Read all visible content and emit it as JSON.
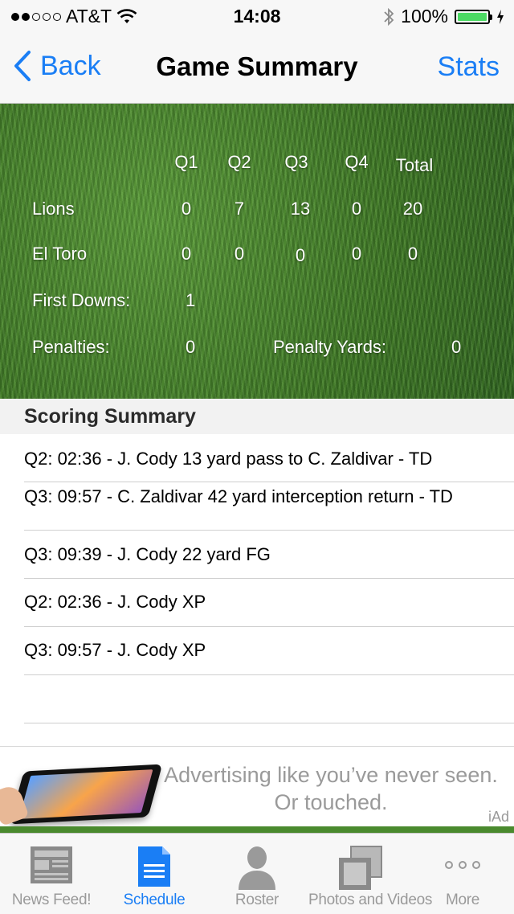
{
  "status_bar": {
    "carrier": "AT&T",
    "time": "14:08",
    "battery": "100%",
    "battery_level": 1.0,
    "signal_bars": 2
  },
  "nav": {
    "back_label": "Back",
    "title": "Game Summary",
    "right_label": "Stats"
  },
  "scoreboard": {
    "headers": [
      "Q1",
      "Q2",
      "Q3",
      "Q4",
      "Total"
    ],
    "teams": [
      {
        "name": "Lions",
        "scores": [
          "0",
          "7",
          "13",
          "0",
          "20"
        ]
      },
      {
        "name": "El Toro",
        "scores": [
          "0",
          "0",
          "0",
          "0",
          "0"
        ]
      }
    ],
    "first_downs_label": "First Downs:",
    "first_downs_value": "1",
    "penalties_label": "Penalties:",
    "penalties_value": "0",
    "penalty_yards_label": "Penalty Yards:",
    "penalty_yards_value": "0"
  },
  "scoring_summary": {
    "title": "Scoring Summary",
    "plays": [
      "Q2: 02:36 - J. Cody 13 yard pass to C. Zaldivar - TD",
      "Q3: 09:57 - C. Zaldivar 42 yard interception return - TD",
      "Q3: 09:39 - J. Cody 22 yard FG",
      "Q2: 02:36 - J. Cody XP",
      "Q3: 09:57 - J. Cody XP",
      ""
    ]
  },
  "ad": {
    "line1": "Advertising like you’ve never seen.",
    "line2": "Or touched.",
    "badge": "iAd"
  },
  "tabs": [
    {
      "label": "News Feed!",
      "icon": "newspaper-icon",
      "active": false
    },
    {
      "label": "Schedule",
      "icon": "document-icon",
      "active": true
    },
    {
      "label": "Roster",
      "icon": "person-icon",
      "active": false
    },
    {
      "label": "Photos and Videos",
      "icon": "photos-icon",
      "active": false
    },
    {
      "label": "More",
      "icon": "more-icon",
      "active": false
    }
  ],
  "colors": {
    "accent": "#1a7ef5",
    "battery": "#4cd964",
    "grass": "#3f7a26"
  }
}
